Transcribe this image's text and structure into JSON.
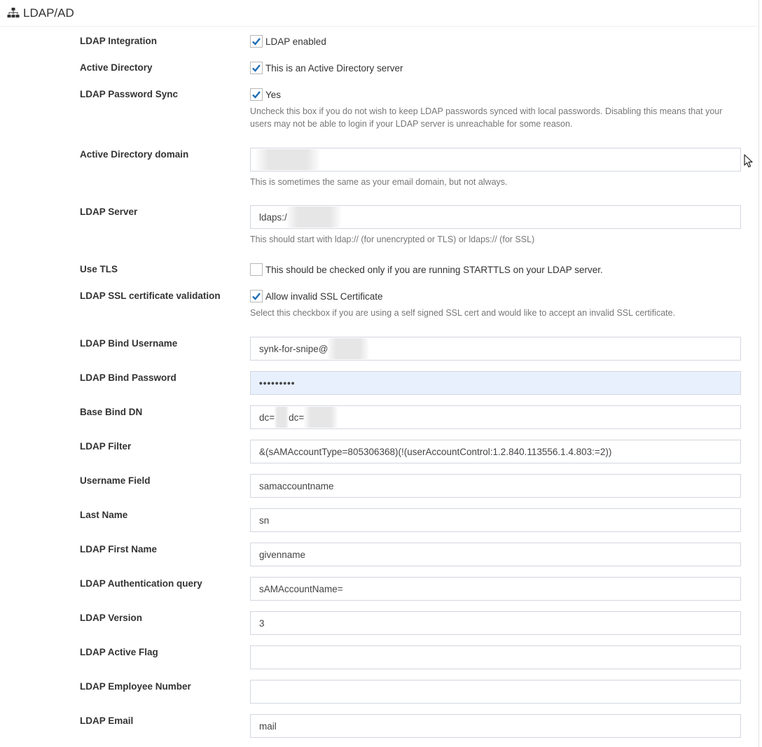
{
  "header": {
    "title": "LDAP/AD"
  },
  "fields": {
    "ldap_integration": {
      "label": "LDAP Integration",
      "checkbox_label": "LDAP enabled",
      "checked": true
    },
    "active_directory": {
      "label": "Active Directory",
      "checkbox_label": "This is an Active Directory server",
      "checked": true
    },
    "password_sync": {
      "label": "LDAP Password Sync",
      "checkbox_label": "Yes",
      "checked": true,
      "help": "Uncheck this box if you do not wish to keep LDAP passwords synced with local passwords. Disabling this means that your users may not be able to login if your LDAP server is unreachable for some reason."
    },
    "ad_domain": {
      "label": "Active Directory domain",
      "value": "",
      "help": "This is sometimes the same as your email domain, but not always."
    },
    "ldap_server": {
      "label": "LDAP Server",
      "value": "ldaps:/",
      "help": "This should start with ldap:// (for unencrypted or TLS) or ldaps:// (for SSL)"
    },
    "use_tls": {
      "label": "Use TLS",
      "checkbox_label": "This should be checked only if you are running STARTTLS on your LDAP server.",
      "checked": false
    },
    "ssl_validation": {
      "label": "LDAP SSL certificate validation",
      "checkbox_label": "Allow invalid SSL Certificate",
      "checked": true,
      "help": "Select this checkbox if you are using a self signed SSL cert and would like to accept an invalid SSL certificate."
    },
    "bind_username": {
      "label": "LDAP Bind Username",
      "value": "synk-for-snipe@"
    },
    "bind_password": {
      "label": "LDAP Bind Password",
      "value": "•••••••••"
    },
    "base_dn": {
      "label": "Base Bind DN",
      "value_a": "dc=",
      "value_b": "dc="
    },
    "ldap_filter": {
      "label": "LDAP Filter",
      "value": "&(sAMAccountType=805306368)(!(userAccountControl:1.2.840.113556.1.4.803:=2))"
    },
    "username_field": {
      "label": "Username Field",
      "value": "samaccountname"
    },
    "last_name": {
      "label": "Last Name",
      "value": "sn"
    },
    "first_name": {
      "label": "LDAP First Name",
      "value": "givenname"
    },
    "auth_query": {
      "label": "LDAP Authentication query",
      "value": "sAMAccountName="
    },
    "version": {
      "label": "LDAP Version",
      "value": "3"
    },
    "active_flag": {
      "label": "LDAP Active Flag",
      "value": ""
    },
    "employee_number": {
      "label": "LDAP Employee Number",
      "value": ""
    },
    "email": {
      "label": "LDAP Email",
      "value": "mail"
    }
  },
  "icons": {
    "header": "sitemap-icon",
    "check": "checkmark-icon",
    "cursor": "mouse-pointer-icon"
  },
  "colors": {
    "check": "#1f6fb5",
    "input_border": "#d2d6de",
    "autofill_bg": "#e8f0fe",
    "help_text": "#777777"
  }
}
